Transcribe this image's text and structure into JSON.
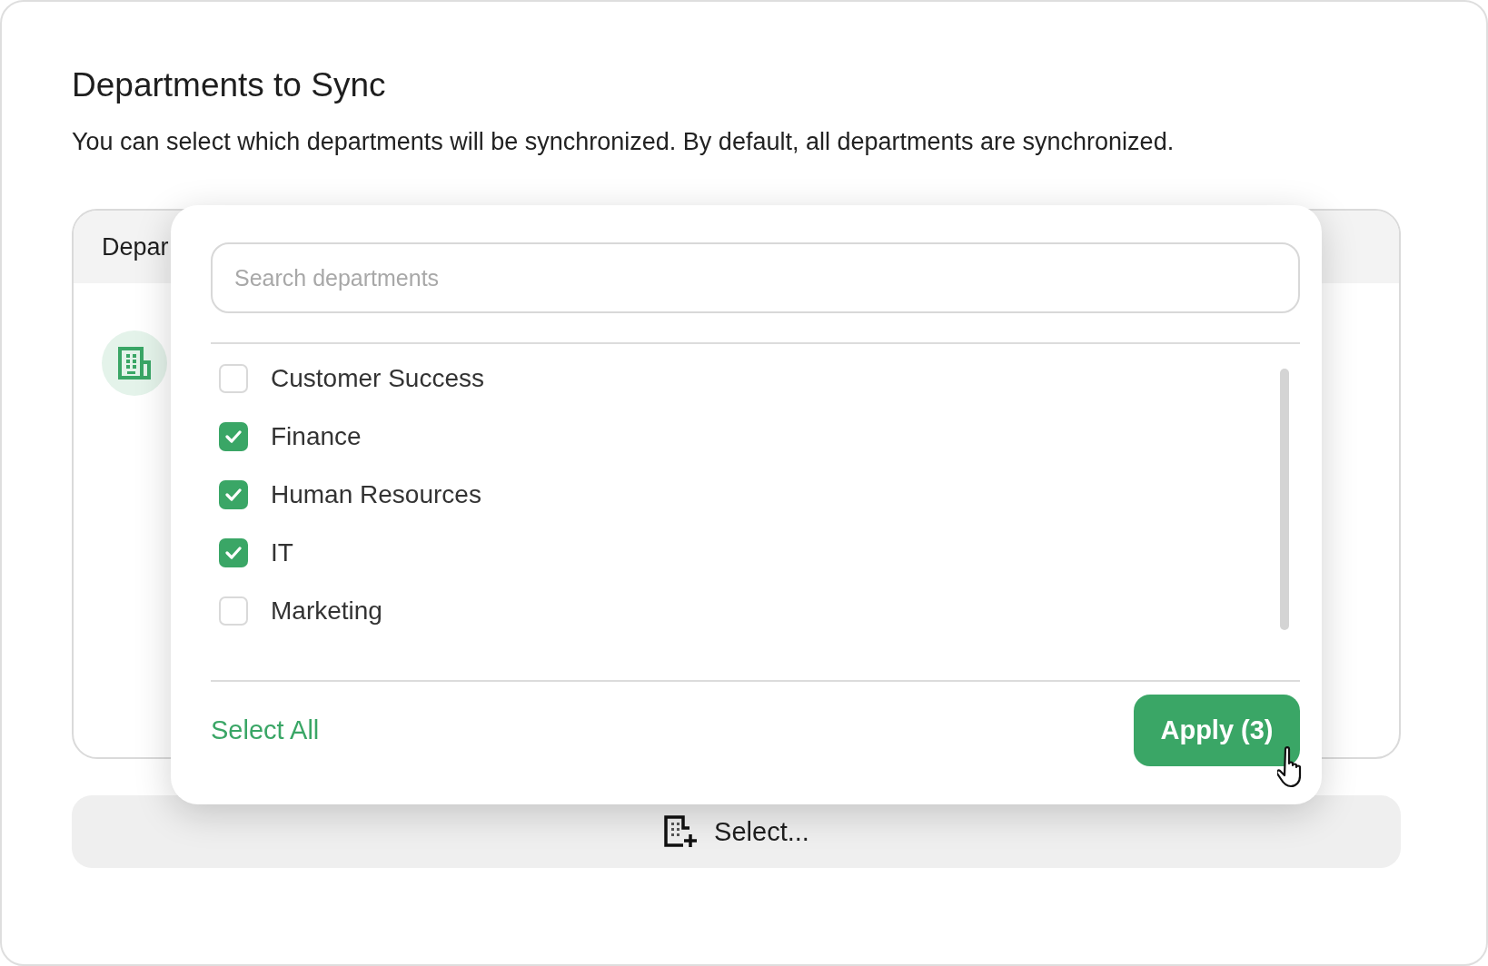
{
  "section": {
    "title": "Departments to Sync",
    "description": "You can select which departments will be synchronized. By default, all departments are synchronized."
  },
  "table": {
    "header": "Depar"
  },
  "popover": {
    "search": {
      "placeholder": "Search departments"
    },
    "departments": [
      {
        "label": "Customer Success",
        "checked": false
      },
      {
        "label": "Finance",
        "checked": true
      },
      {
        "label": "Human Resources",
        "checked": true
      },
      {
        "label": "IT",
        "checked": true
      },
      {
        "label": "Marketing",
        "checked": false
      }
    ],
    "select_all": "Select All",
    "apply": "Apply (3)"
  },
  "select_button": "Select..."
}
